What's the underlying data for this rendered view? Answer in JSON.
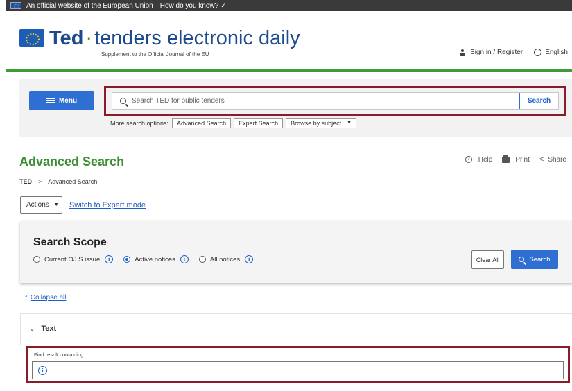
{
  "eu_banner": {
    "official_text": "An official website of the European Union",
    "how_text": "How do you know?"
  },
  "header": {
    "logo_ted": "Ted",
    "logo_rest": "tenders electronic daily",
    "subtitle": "Supplement to the Official Journal of the EU",
    "sign_in": "Sign in / Register",
    "language": "English"
  },
  "search_band": {
    "menu_label": "Menu",
    "search_placeholder": "Search TED for public tenders",
    "search_button": "Search",
    "more_options_label": "More search options:",
    "advanced_search": "Advanced Search",
    "expert_search": "Expert Search",
    "browse_by_subject": "Browse by subject"
  },
  "page": {
    "title": "Advanced Search",
    "help": "Help",
    "print": "Print",
    "share": "Share",
    "breadcrumb": [
      "TED",
      "Advanced Search"
    ],
    "actions_label": "Actions",
    "expert_mode_link": "Switch to Expert mode"
  },
  "scope": {
    "title": "Search Scope",
    "options": [
      {
        "label": "Current OJ S issue",
        "selected": false
      },
      {
        "label": "Active notices",
        "selected": true
      },
      {
        "label": "All notices",
        "selected": false
      }
    ],
    "clear_all": "Clear All",
    "search_button": "Search"
  },
  "collapse_all": "Collapse all",
  "text_section": {
    "heading": "Text",
    "find_label": "Find result containing",
    "find_value": ""
  },
  "colors": {
    "primary_blue": "#2f6fd4",
    "brand_green": "#3f9c35",
    "highlight_red": "#8b1a2b"
  }
}
